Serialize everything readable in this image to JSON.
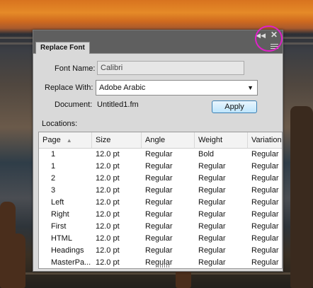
{
  "panel": {
    "tab_label": "Replace Font",
    "font_name_label": "Font Name:",
    "font_name_value": "Calibri",
    "replace_with_label": "Replace With:",
    "replace_with_value": "Adobe Arabic",
    "document_label": "Document:",
    "document_value": "Untitled1.fm",
    "apply_label": "Apply",
    "locations_label": "Locations:"
  },
  "icons": {
    "collapse": "double-chevron-left-icon",
    "close": "close-icon",
    "menu": "panel-menu-icon"
  },
  "table": {
    "columns": [
      "Page",
      "Size",
      "Angle",
      "Weight",
      "Variation"
    ],
    "rows": [
      [
        "1",
        "12.0 pt",
        "Regular",
        "Bold",
        "Regular"
      ],
      [
        "1",
        "12.0 pt",
        "Regular",
        "Regular",
        "Regular"
      ],
      [
        "2",
        "12.0 pt",
        "Regular",
        "Regular",
        "Regular"
      ],
      [
        "3",
        "12.0 pt",
        "Regular",
        "Regular",
        "Regular"
      ],
      [
        "Left",
        "12.0 pt",
        "Regular",
        "Regular",
        "Regular"
      ],
      [
        "Right",
        "12.0 pt",
        "Regular",
        "Regular",
        "Regular"
      ],
      [
        "First",
        "12.0 pt",
        "Regular",
        "Regular",
        "Regular"
      ],
      [
        "HTML",
        "12.0 pt",
        "Regular",
        "Regular",
        "Regular"
      ],
      [
        "Headings",
        "12.0 pt",
        "Regular",
        "Regular",
        "Regular"
      ],
      [
        "MasterPa...",
        "12.0 pt",
        "Regular",
        "Regular",
        "Regular"
      ]
    ]
  },
  "colors": {
    "highlight": "#e020c8",
    "panel_bg": "#d9d9d9",
    "titlebar": "#5f5f5f"
  }
}
